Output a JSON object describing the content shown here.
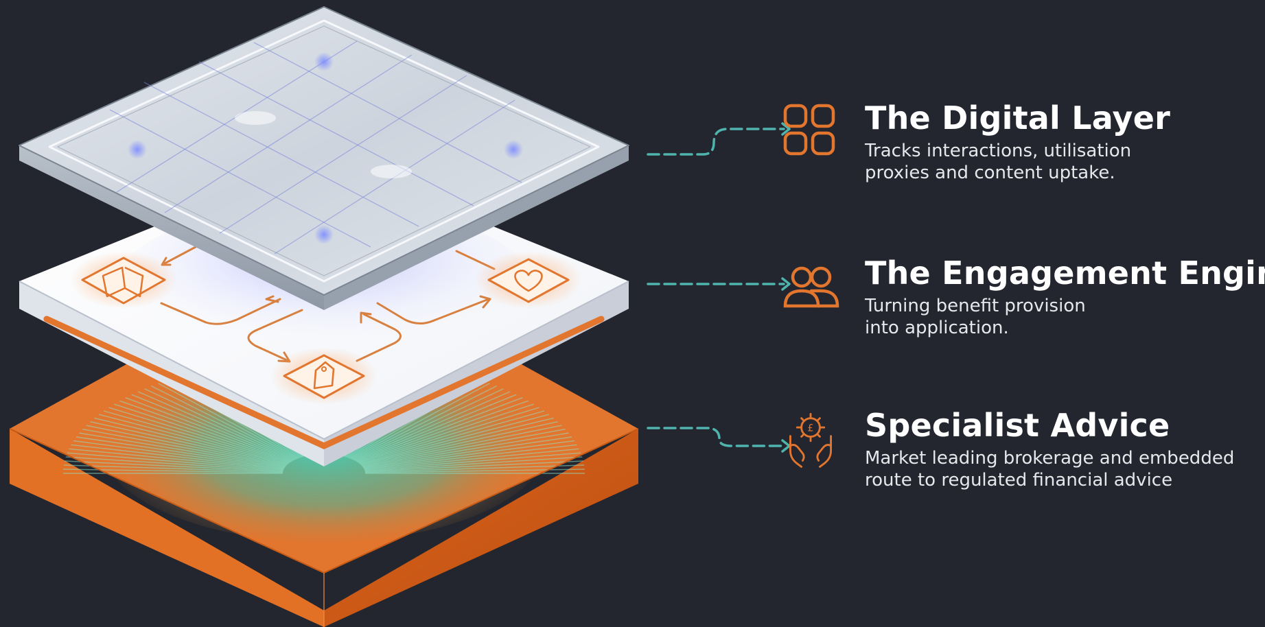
{
  "layers": [
    {
      "title": "The Digital Layer",
      "description_line1": "Tracks interactions, utilisation",
      "description_line2": "proxies and content uptake.",
      "icon": "grid-icon"
    },
    {
      "title": "The Engagement Engine",
      "description_line1": "Turning benefit provision",
      "description_line2": "into application.",
      "icon": "users-icon"
    },
    {
      "title": "Specialist Advice",
      "description_line1": "Market leading brokerage and embedded",
      "description_line2": "route to regulated financial advice",
      "icon": "hands-pound-gear-icon"
    }
  ],
  "colors": {
    "background": "#23262e",
    "accent_orange": "#e2762f",
    "connector_teal": "#4fb3ae",
    "text_primary": "#ffffff",
    "text_secondary": "#e6e8ec"
  }
}
